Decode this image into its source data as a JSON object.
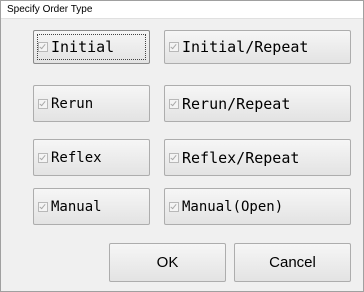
{
  "window": {
    "title": "Specify Order Type"
  },
  "order_types": [
    {
      "label": "Initial",
      "checked": true
    },
    {
      "label": "Initial/Repeat",
      "checked": true
    },
    {
      "label": "Rerun",
      "checked": true
    },
    {
      "label": "Rerun/Repeat",
      "checked": true
    },
    {
      "label": "Reflex",
      "checked": true
    },
    {
      "label": "Reflex/Repeat",
      "checked": true
    },
    {
      "label": "Manual",
      "checked": true
    },
    {
      "label": "Manual(Open)",
      "checked": true
    }
  ],
  "actions": {
    "ok_label": "OK",
    "cancel_label": "Cancel"
  },
  "icons": {
    "checkbox": "checkbox-icon"
  }
}
